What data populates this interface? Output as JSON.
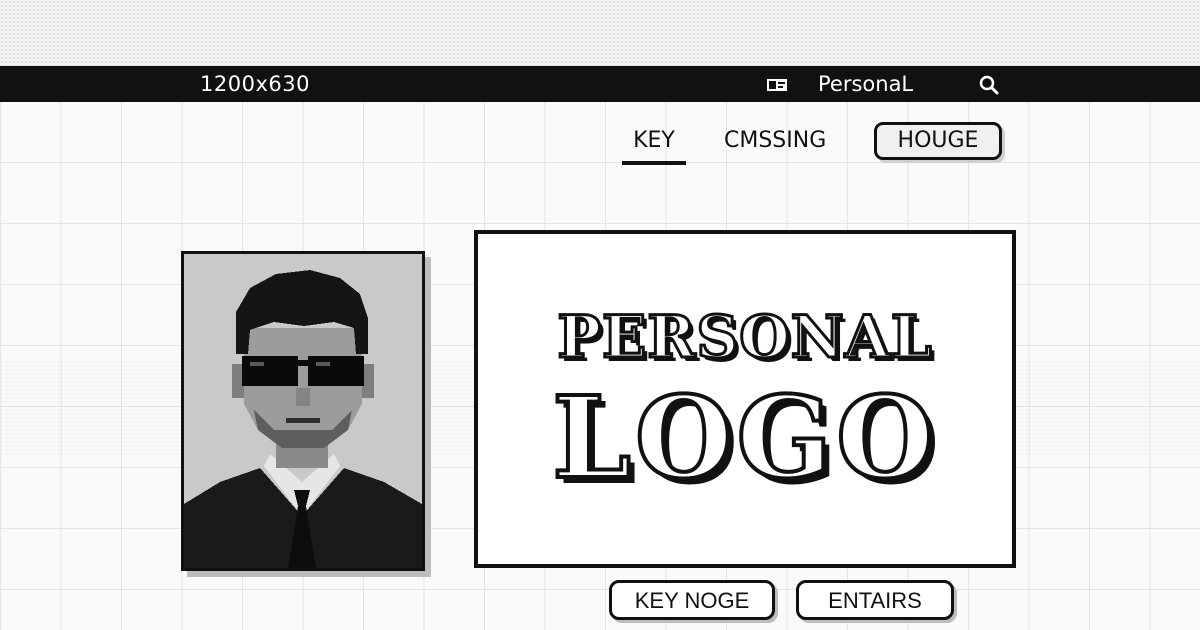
{
  "topbar": {
    "dimensions_label": "1200x630",
    "profile_icon": "id-card-icon",
    "user_name": "PersonaL",
    "search_icon": "search-icon"
  },
  "nav": {
    "tabs": [
      {
        "label": "KEY",
        "active": true
      },
      {
        "label": "CMSSING",
        "active": false
      },
      {
        "label": "HOUGE",
        "active": false,
        "style": "boxed"
      }
    ]
  },
  "portrait": {
    "description_icon": "person-with-sunglasses-portrait"
  },
  "logo": {
    "line1": "PERSONAL",
    "line2": "LOGO"
  },
  "actions": {
    "primary_label": "KEY NOGE",
    "secondary_label": "ENTAIRS"
  },
  "colors": {
    "bar": "#111111",
    "background": "#fafafa",
    "grid": "#e4e4e4",
    "ink": "#111111"
  }
}
